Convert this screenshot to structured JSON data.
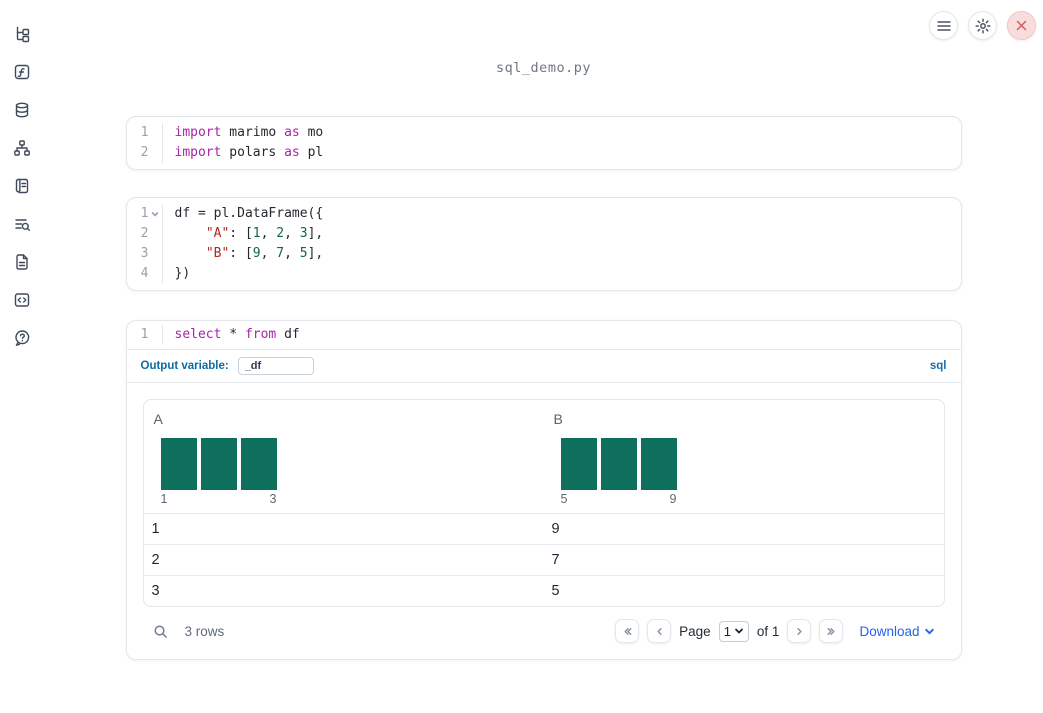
{
  "app": {
    "title": "sql_demo.py"
  },
  "topbar": {
    "icons": [
      "hamburger-menu",
      "gear-settings",
      "close-x"
    ]
  },
  "sidebar": {
    "icons": [
      "file-tree",
      "function-square",
      "database",
      "dependency-graph",
      "script-scroll",
      "list-search",
      "document",
      "code-snippet",
      "help-chat"
    ]
  },
  "cells": [
    {
      "lines": [
        {
          "num": "1",
          "tokens": [
            "import",
            " marimo ",
            "as",
            " mo"
          ]
        },
        {
          "num": "2",
          "tokens": [
            "import",
            " polars ",
            "as",
            " pl"
          ]
        }
      ]
    },
    {
      "lines": [
        {
          "num": "1",
          "tokens": [
            "df = pl.DataFrame({"
          ]
        },
        {
          "num": "2",
          "tokens": [
            "    ",
            "\"A\"",
            ": [",
            "1",
            ", ",
            "2",
            ", ",
            "3",
            "],"
          ]
        },
        {
          "num": "3",
          "tokens": [
            "    ",
            "\"B\"",
            ": [",
            "9",
            ", ",
            "7",
            ", ",
            "5",
            "],"
          ]
        },
        {
          "num": "4",
          "tokens": [
            "})"
          ]
        }
      ]
    }
  ],
  "sql_cell": {
    "line_num": "1",
    "tokens": [
      "select",
      " * ",
      "from",
      " df"
    ],
    "output_variable_label": "Output variable:",
    "output_variable_value": "_df",
    "language_badge": "sql"
  },
  "output_table": {
    "columns": [
      {
        "name": "A",
        "histogram": {
          "bar_count": 3,
          "min_label": "1",
          "max_label": "3"
        }
      },
      {
        "name": "B",
        "histogram": {
          "bar_count": 3,
          "min_label": "5",
          "max_label": "9"
        }
      }
    ],
    "rows": [
      {
        "A": "1",
        "B": "9"
      },
      {
        "A": "2",
        "B": "7"
      },
      {
        "A": "3",
        "B": "5"
      }
    ],
    "footer": {
      "row_count": "3 rows",
      "pagination": {
        "page_label": "Page",
        "page_value": "1",
        "of_label": "of 1"
      },
      "download_label": "Download"
    }
  },
  "colors": {
    "accent_blue": "#2563eb",
    "keyword_purple": "#a626a4",
    "string_red": "#b02a20",
    "number_green": "#116644",
    "histogram_bar": "#0e6f5c",
    "sql_badge_blue": "#1a6fb0",
    "output_variable_label": "#0c6d9e",
    "close_button_red": "#cf5f5f"
  }
}
